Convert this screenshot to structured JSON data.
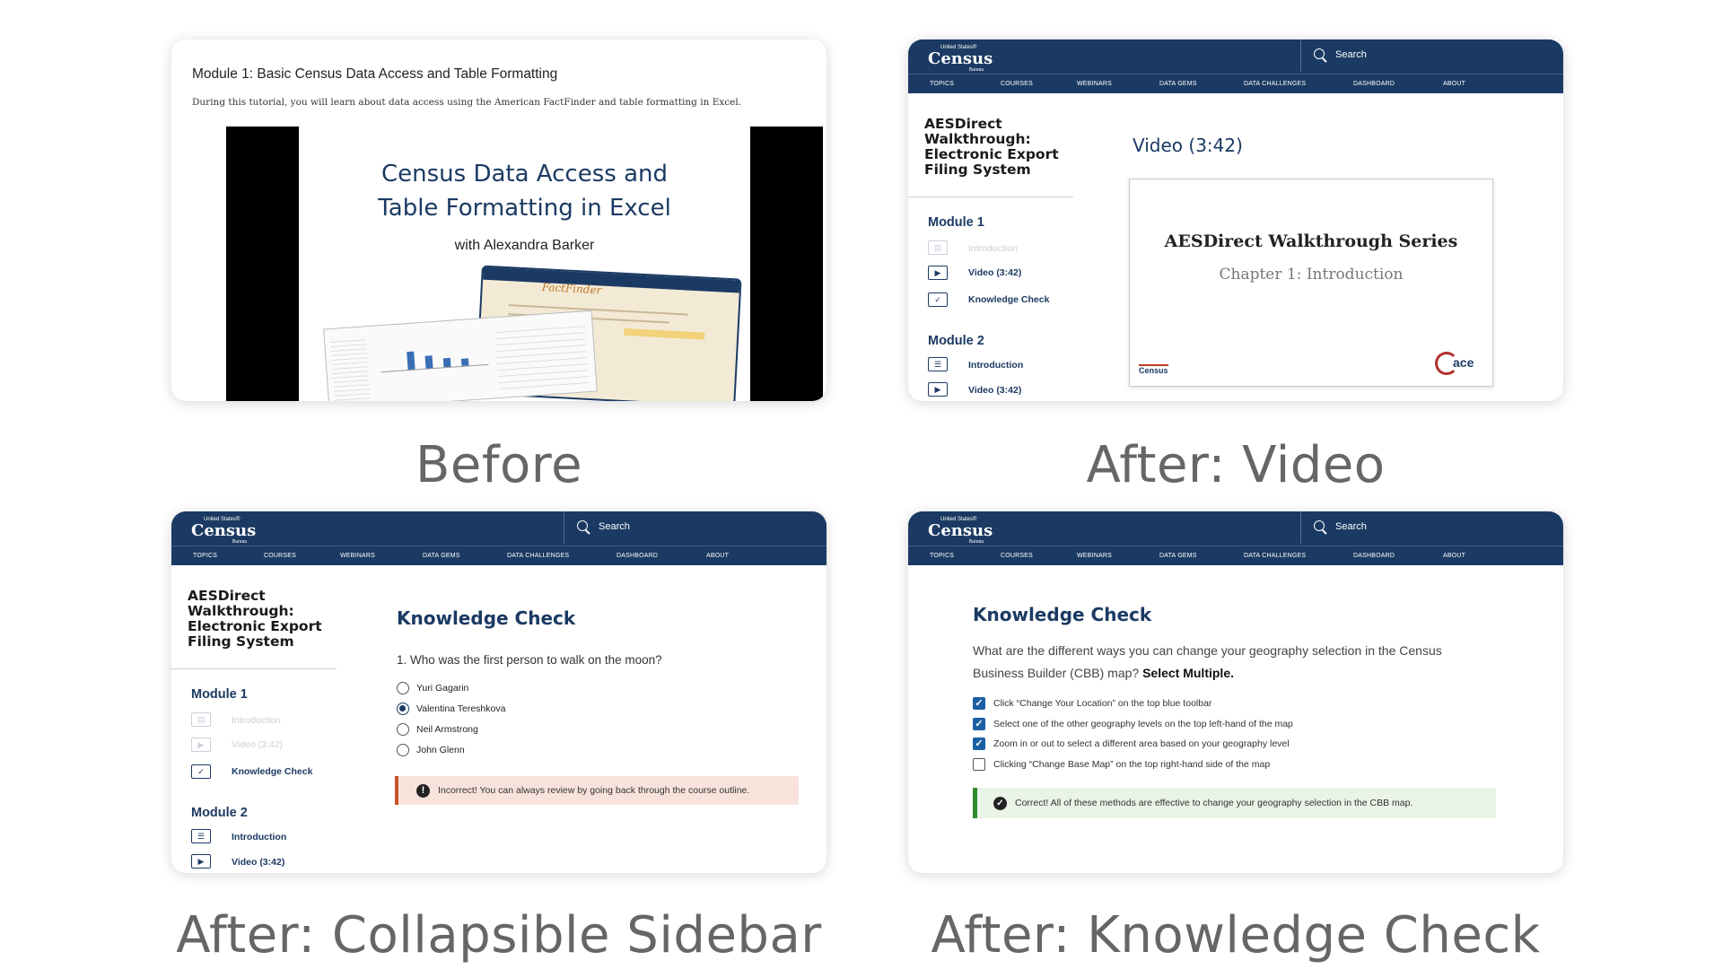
{
  "captions": {
    "before": "Before",
    "video": "After: Video",
    "sidebar": "After: Collapsible Sidebar",
    "kc": "After: Knowledge Check"
  },
  "census": {
    "logo_small": "United States®",
    "logo_big": "Census",
    "logo_tiny": "Bureau",
    "search": "Search",
    "nav": [
      "TOPICS",
      "COURSES",
      "WEBINARS",
      "DATA GEMS",
      "DATA CHALLENGES",
      "DASHBOARD",
      "ABOUT"
    ]
  },
  "before": {
    "title": "Module 1: Basic Census Data Access and Table Formatting",
    "desc": "During this tutorial, you will learn about data access using the American FactFinder and table formatting in Excel.",
    "video_title_1": "Census Data Access and",
    "video_title_2": "Table Formatting in Excel",
    "video_presenter": "with Alexandra Barker",
    "factfinder": "FactFinder"
  },
  "sidebar": {
    "course_title": "AESDirect Walkthrough: Electronic Export Filing System",
    "module1": "Module 1",
    "module2": "Module 2",
    "intro": "Introduction",
    "video": "Video (3:42)",
    "kc": "Knowledge Check"
  },
  "video_card": {
    "heading": "Video (3:42)",
    "slide_title": "AESDirect Walkthrough Series",
    "slide_sub": "Chapter 1: Introduction",
    "ace": "ace",
    "census_mark": "Census"
  },
  "kc1": {
    "heading": "Knowledge Check",
    "question": "1. Who was the first person to walk on the moon?",
    "options": [
      "Yuri Gagarin",
      "Valentina Tereshkova",
      "Neil Armstrong",
      "John Glenn"
    ],
    "selected": 1,
    "feedback": "Incorrect! You can always review by going back through the course outline."
  },
  "kc2": {
    "heading": "Knowledge Check",
    "question_1": "What are the different ways you can change your geography selection in the Census",
    "question_2": "Business Builder (CBB) map?",
    "question_bold": "Select Multiple.",
    "options": [
      "Click “Change Your Location” on the top blue toolbar",
      "Select one of the other geography levels on the top left-hand of the map",
      "Zoom in or out to select a different area based on your geography level",
      "Clicking “Change Base Map” on the top right-hand side of the map"
    ],
    "checked": [
      true,
      true,
      true,
      false
    ],
    "feedback": "Correct! All of these methods are effective to change your geography selection in the CBB map."
  },
  "colors": {
    "navy": "#1b3a63",
    "error_bg": "#f8e3dc",
    "error_bar": "#c8532a",
    "success_bg": "#e9f3e6",
    "success_bar": "#2e8b2e"
  }
}
